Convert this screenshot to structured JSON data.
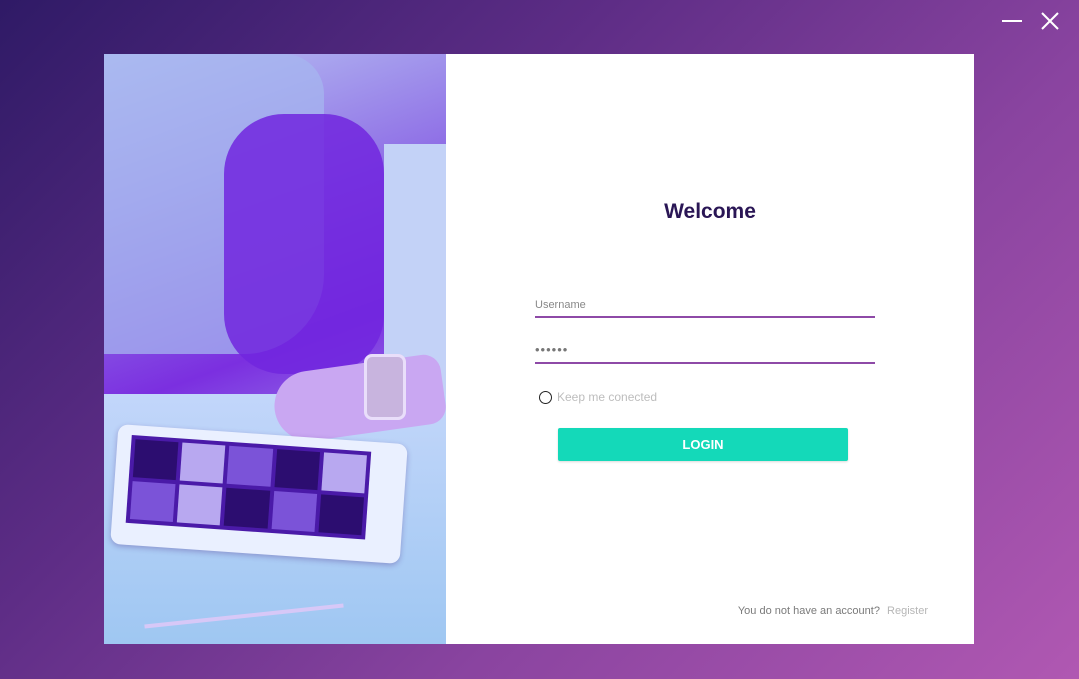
{
  "window": {
    "minimize_icon": "minimize-icon",
    "close_icon": "close-icon"
  },
  "hero": {
    "description_icon": "tablet-photo"
  },
  "login": {
    "title": "Welcome",
    "username_placeholder": "Username",
    "password_value": "••••••",
    "keep_connected_label": "Keep me conected",
    "keep_connected_checked": false,
    "login_button": "LOGIN",
    "no_account_text": "You do not have an account?",
    "register_link": "Register"
  },
  "colors": {
    "accent_button": "#14d9b9",
    "field_underline": "#8e4aa7",
    "title_text": "#2a1655",
    "background_start": "#2f1a66",
    "background_end": "#b058b2"
  }
}
